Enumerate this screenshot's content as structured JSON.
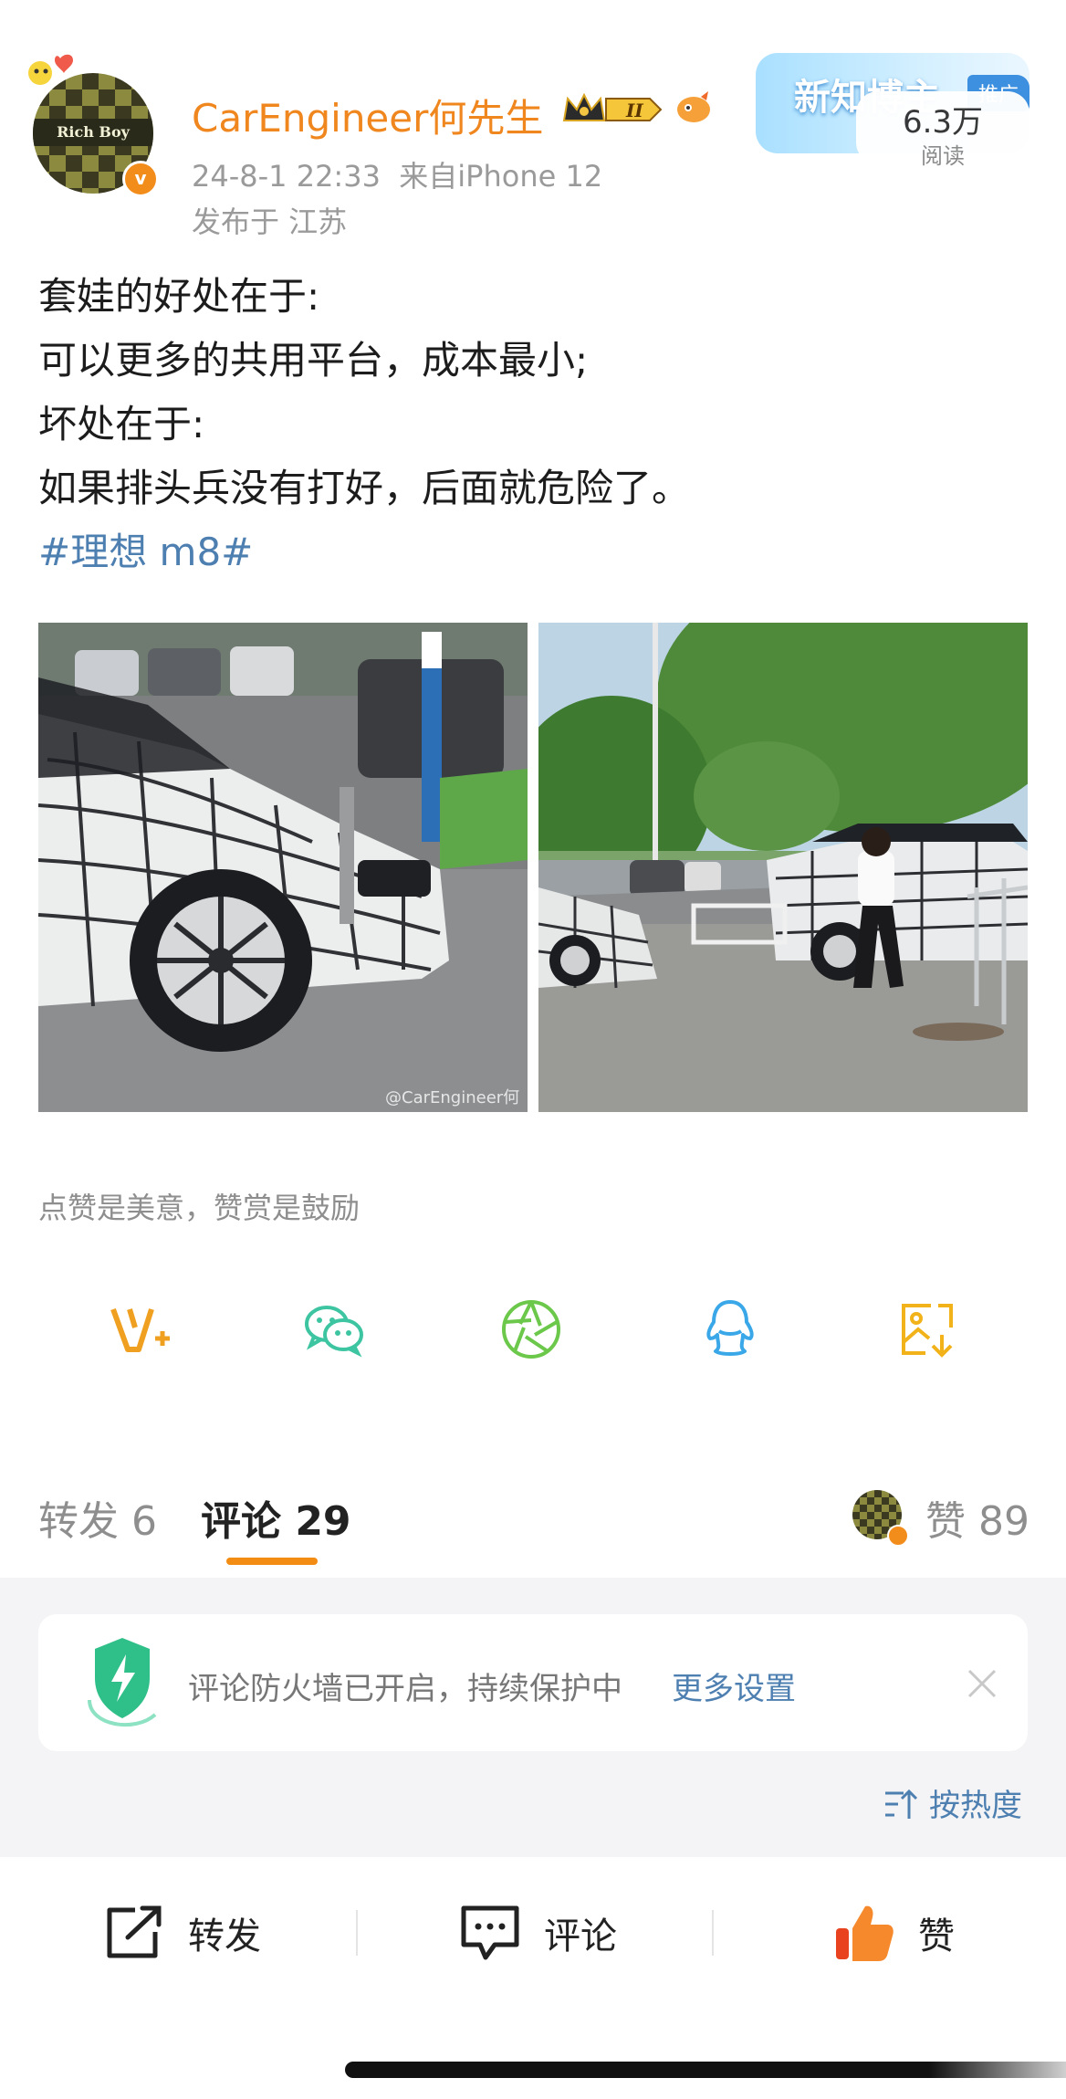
{
  "post": {
    "username": "CarEngineer何先生",
    "avatar_text": "Rich Boy",
    "level_badge": "II",
    "timestamp": "24-8-1 22:33",
    "source": "来自iPhone 12",
    "location": "发布于 江苏",
    "promo": {
      "title": "新知博主",
      "tag": "推广",
      "reads": "6.3万",
      "reads_label": "阅读"
    },
    "text_lines": [
      "套娃的好处在于:",
      "可以更多的共用平台，成本最小;",
      "坏处在于:",
      "如果排头兵没有打好，后面就危险了。"
    ],
    "hashtag": "#理想 m8#",
    "image_watermark": "@CarEngineer何",
    "reward_text": "点赞是美意，赞赏是鼓励"
  },
  "share_row": [
    {
      "icon": "vplus-icon",
      "color": "#f0a020"
    },
    {
      "icon": "wechat-icon",
      "color": "#3dc5a2"
    },
    {
      "icon": "moments-icon",
      "color": "#6cc84a"
    },
    {
      "icon": "qq-icon",
      "color": "#3aa8e8"
    },
    {
      "icon": "save-image-icon",
      "color": "#f2b21a"
    }
  ],
  "tabs": {
    "repost": "转发 6",
    "comment": "评论 29",
    "like": "赞 89"
  },
  "firewall": {
    "text": "评论防火墙已开启，持续保护中",
    "link": "更多设置"
  },
  "sort": {
    "label": "按热度"
  },
  "bottom_bar": {
    "repost": "转发",
    "comment": "评论",
    "like": "赞"
  },
  "colors": {
    "accent_orange": "#f0861e",
    "link_blue": "#4e7fb1",
    "meta_gray": "#9a9a9a"
  }
}
